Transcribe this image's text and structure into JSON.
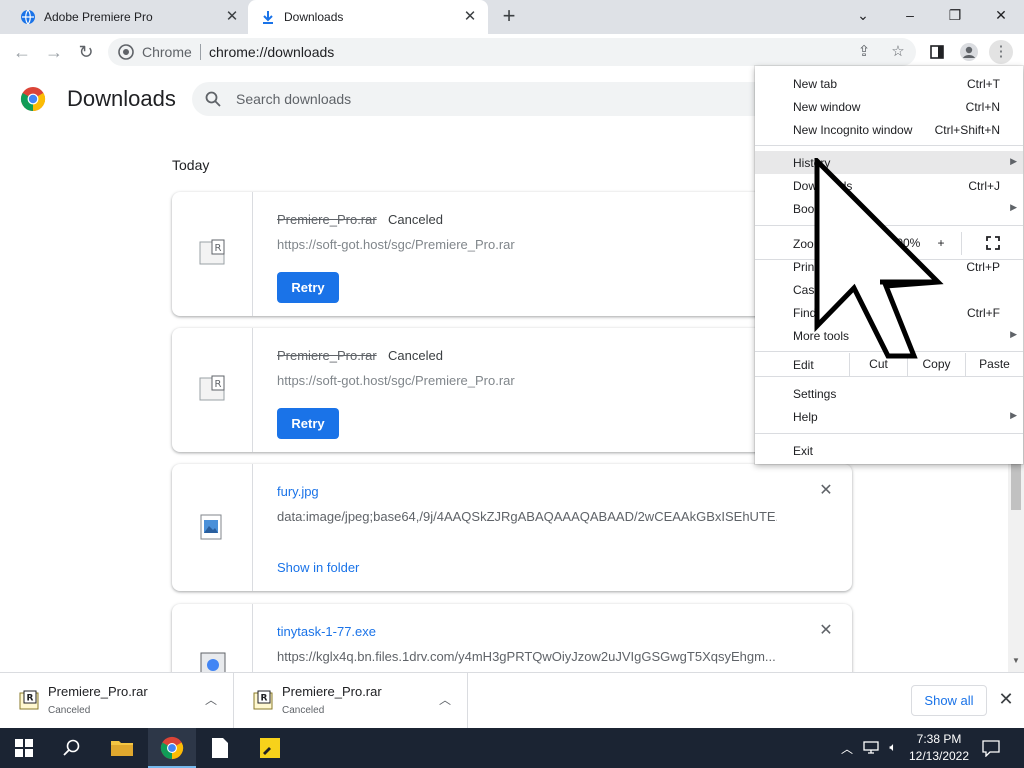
{
  "browser": {
    "tabs": [
      {
        "title": "Adobe Premiere Pro"
      },
      {
        "title": "Downloads"
      }
    ],
    "omnibox": {
      "site_chip": "Chrome",
      "url": "chrome://downloads"
    }
  },
  "page": {
    "title": "Downloads",
    "search_placeholder": "Search downloads",
    "section_label": "Today",
    "downloads": [
      {
        "filename": "Premiere_Pro.rar",
        "status": "Canceled",
        "url": "https://soft-got.host/sgc/Premiere_Pro.rar",
        "action": "Retry"
      },
      {
        "filename": "Premiere_Pro.rar",
        "status": "Canceled",
        "url": "https://soft-got.host/sgc/Premiere_Pro.rar",
        "action": "Retry"
      },
      {
        "filename": "fury.jpg",
        "url": "data:image/jpeg;base64,/9j/4AAQSkZJRgABAQAAAQABAAD/2wCEAAkGBxISEhUTE...",
        "action": "Show in folder"
      },
      {
        "filename": "tinytask-1-77.exe",
        "url": "https://kglx4q.bn.files.1drv.com/y4mH3gPRTQwOiyJzow2uJVIgGSGwgT5XqsyEhgm..."
      }
    ]
  },
  "menu": {
    "items": {
      "new_tab": {
        "label": "New tab",
        "shortcut": "Ctrl+T"
      },
      "new_window": {
        "label": "New window",
        "shortcut": "Ctrl+N"
      },
      "new_incognito": {
        "label": "New Incognito window",
        "shortcut": "Ctrl+Shift+N"
      },
      "history": {
        "label": "History"
      },
      "downloads": {
        "label": "Downloads",
        "shortcut": "Ctrl+J"
      },
      "bookmarks": {
        "label": "Bookmarks"
      },
      "zoom": {
        "label": "Zoom",
        "minus": "−",
        "value": "100%",
        "plus": "+"
      },
      "print": {
        "label": "Print...",
        "shortcut": "Ctrl+P"
      },
      "cast": {
        "label": "Cast..."
      },
      "find": {
        "label": "Find...",
        "shortcut": "Ctrl+F"
      },
      "more_tools": {
        "label": "More tools"
      },
      "edit": {
        "label": "Edit",
        "cut": "Cut",
        "copy": "Copy",
        "paste": "Paste"
      },
      "settings": {
        "label": "Settings"
      },
      "help": {
        "label": "Help"
      },
      "exit": {
        "label": "Exit"
      }
    }
  },
  "shelf": {
    "items": [
      {
        "filename": "Premiere_Pro.rar",
        "status": "Canceled"
      },
      {
        "filename": "Premiere_Pro.rar",
        "status": "Canceled"
      }
    ],
    "show_all": "Show all"
  },
  "taskbar": {
    "time": "7:38 PM",
    "date": "12/13/2022"
  },
  "colors": {
    "accent": "#1a73e8",
    "taskbar": "#1b2433"
  }
}
